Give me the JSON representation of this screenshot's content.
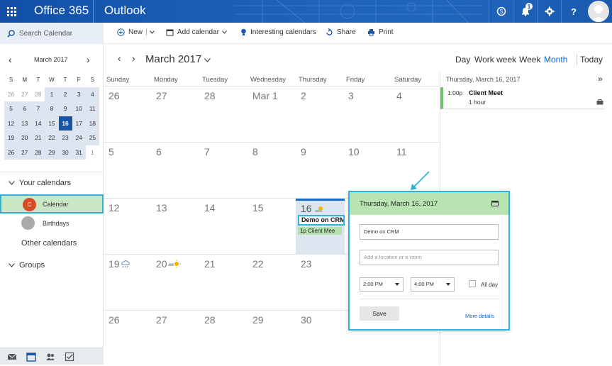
{
  "topbar": {
    "suite": "Office 365",
    "app": "Outlook",
    "notification_count": "1",
    "icons": [
      "waffle-icon",
      "skype-icon",
      "bell-icon",
      "gear-icon",
      "help-icon",
      "user-avatar-icon"
    ],
    "brand_color": "#1250a8"
  },
  "commandbar": {
    "search_placeholder": "Search Calendar",
    "new_label": "New",
    "add_calendar_label": "Add calendar",
    "interesting_label": "Interesting calendars",
    "share_label": "Share",
    "print_label": "Print"
  },
  "minical": {
    "title": "March 2017",
    "prev": "‹",
    "next": "›",
    "dow": [
      "S",
      "M",
      "T",
      "W",
      "T",
      "F",
      "S"
    ],
    "weeks": [
      [
        "26",
        "27",
        "28",
        "1",
        "2",
        "3",
        "4"
      ],
      [
        "5",
        "6",
        "7",
        "8",
        "9",
        "10",
        "11"
      ],
      [
        "12",
        "13",
        "14",
        "15",
        "16",
        "17",
        "18"
      ],
      [
        "19",
        "20",
        "21",
        "22",
        "23",
        "24",
        "25"
      ],
      [
        "26",
        "27",
        "28",
        "29",
        "30",
        "31",
        "1"
      ]
    ],
    "today": "16"
  },
  "sidebar": {
    "your_calendars": "Your calendars",
    "calendar_initial": "C",
    "calendar_label": "Calendar",
    "birthdays_label": "Birthdays",
    "other_calendars": "Other calendars",
    "groups": "Groups"
  },
  "calendar": {
    "month_title": "March 2017",
    "views": [
      "Day",
      "Work week",
      "Week",
      "Month",
      "Today"
    ],
    "active_view": "Month",
    "dow": [
      "Sunday",
      "Monday",
      "Tuesday",
      "Wednesday",
      "Thursday",
      "Friday",
      "Saturday"
    ],
    "weeks": [
      [
        "26",
        "27",
        "28",
        "Mar 1",
        "2",
        "3",
        "4"
      ],
      [
        "5",
        "6",
        "7",
        "8",
        "9",
        "10",
        "11"
      ],
      [
        "12",
        "13",
        "14",
        "15",
        "16",
        "",
        ""
      ],
      [
        "19",
        "20",
        "21",
        "22",
        "23",
        "",
        ""
      ],
      [
        "26",
        "27",
        "28",
        "29",
        "30",
        "",
        ""
      ]
    ],
    "editing_event": "Demo on CRM",
    "event_bar": "1p Client Mee"
  },
  "agenda": {
    "date": "Thursday, March 16, 2017",
    "expand": "»",
    "event_time": "1:00p",
    "event_title": "Client Meet",
    "event_duration": "1 hour",
    "accent": "#6cc465"
  },
  "popup": {
    "date": "Thursday, March 16, 2017",
    "title_value": "Demo on CRM",
    "location_placeholder": "Add a location or a room",
    "start_time": "2:00 PM",
    "end_time": "4:00 PM",
    "allday_label": "All day",
    "save_label": "Save",
    "more_details": "More details",
    "header_color": "#b8e4b2",
    "highlight_color": "#2fb3d8"
  }
}
